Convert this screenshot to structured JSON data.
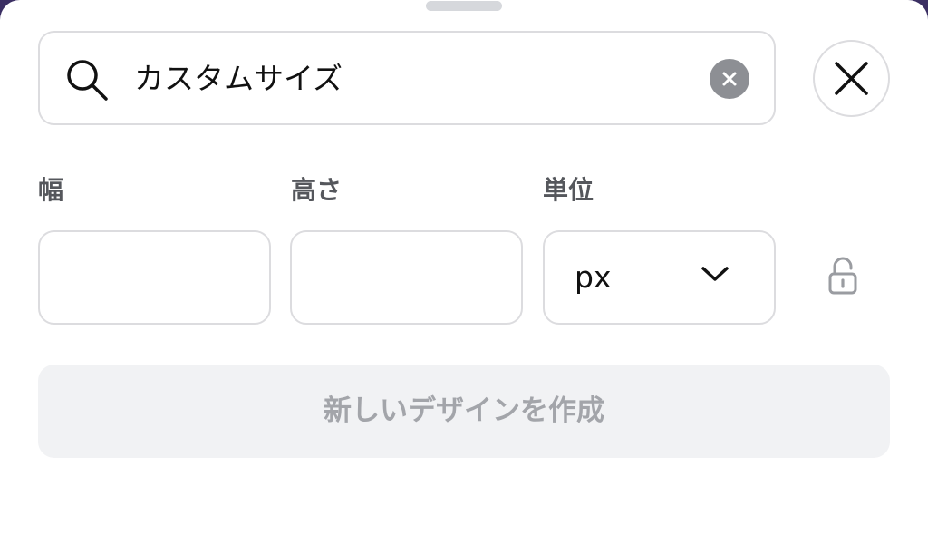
{
  "search": {
    "value": "カスタムサイズ",
    "icon": "search-icon"
  },
  "fields": {
    "width_label": "幅",
    "width_value": "",
    "height_label": "高さ",
    "height_value": "",
    "unit_label": "単位",
    "unit_value": "px"
  },
  "actions": {
    "create_label": "新しいデザインを作成"
  },
  "colors": {
    "border": "#dcdcdf",
    "disabled_bg": "#f1f2f4",
    "disabled_text": "#a3a5aa",
    "clear_button": "#8d8f94"
  }
}
